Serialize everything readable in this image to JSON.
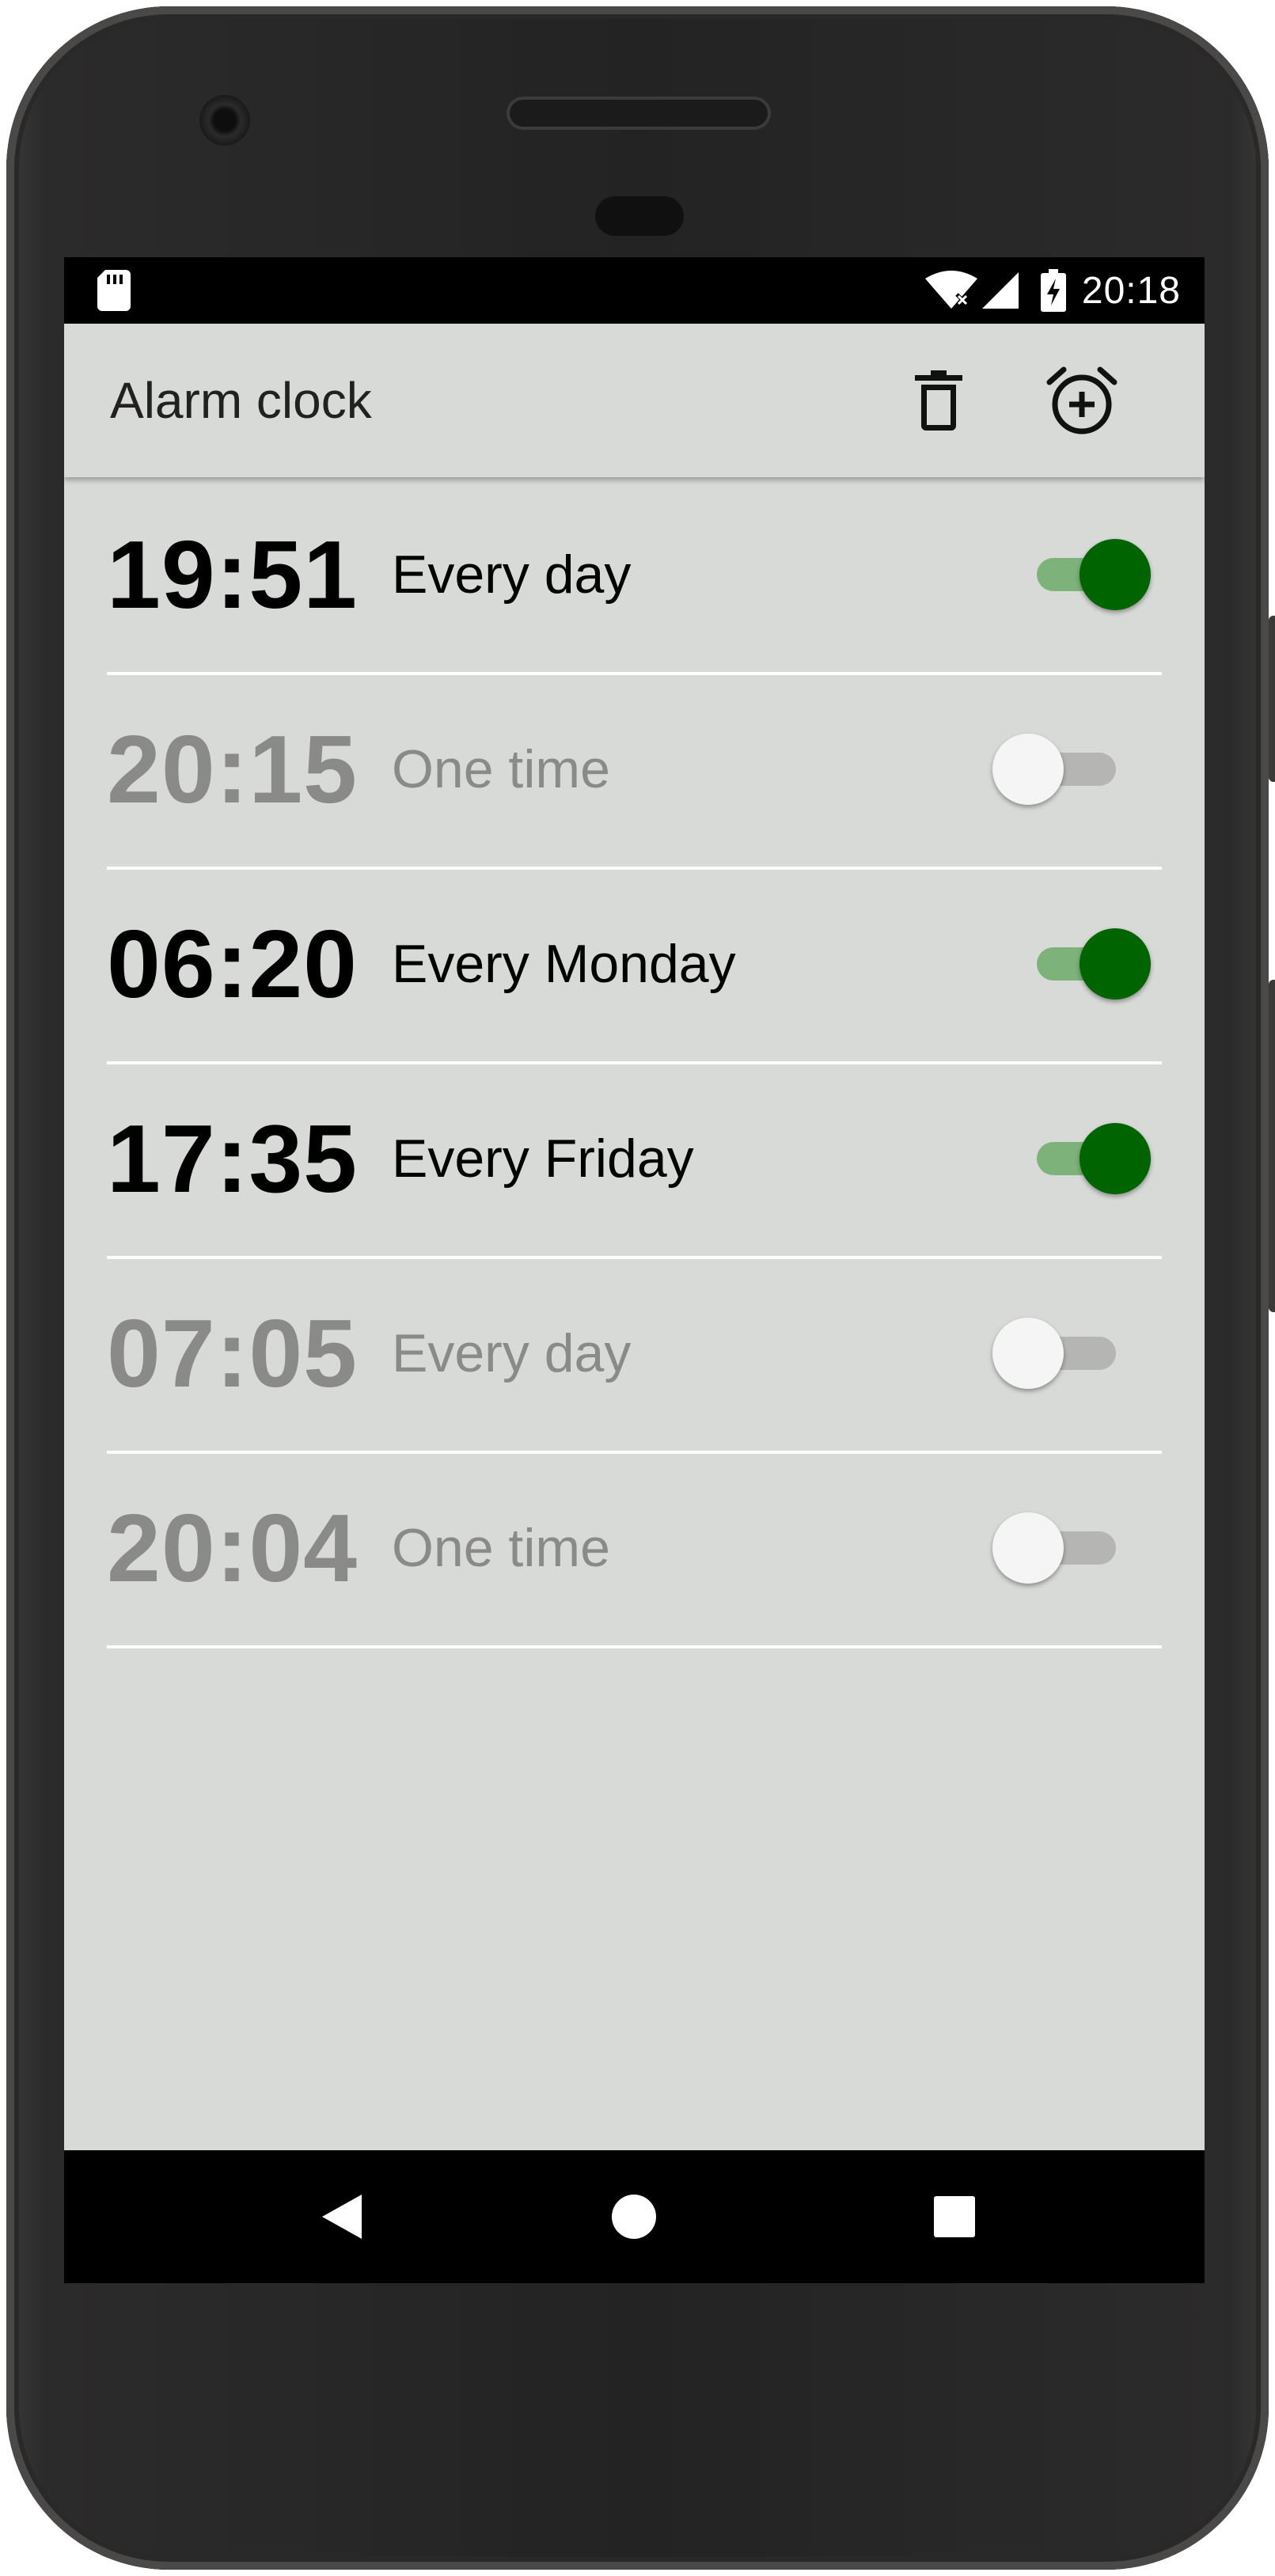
{
  "status_bar": {
    "time": "20:18",
    "icons": [
      "sd-card-icon",
      "wifi-icon",
      "signal-icon",
      "battery-charging-icon"
    ]
  },
  "app_bar": {
    "title": "Alarm clock",
    "actions": [
      "delete-icon",
      "add-alarm-icon"
    ]
  },
  "alarms": [
    {
      "time": "19:51",
      "repeat": "Every day",
      "enabled": true
    },
    {
      "time": "20:15",
      "repeat": "One time",
      "enabled": false
    },
    {
      "time": "06:20",
      "repeat": "Every Monday",
      "enabled": true
    },
    {
      "time": "17:35",
      "repeat": "Every Friday",
      "enabled": true
    },
    {
      "time": "07:05",
      "repeat": "Every day",
      "enabled": false
    },
    {
      "time": "20:04",
      "repeat": "One time",
      "enabled": false
    }
  ],
  "nav_bar": {
    "buttons": [
      "back-icon",
      "home-icon",
      "recents-icon"
    ]
  },
  "colors": {
    "accent": "#006400",
    "accent_track": "#7db37a",
    "background": "#d8dad7",
    "disabled_text": "#8a8b89"
  }
}
